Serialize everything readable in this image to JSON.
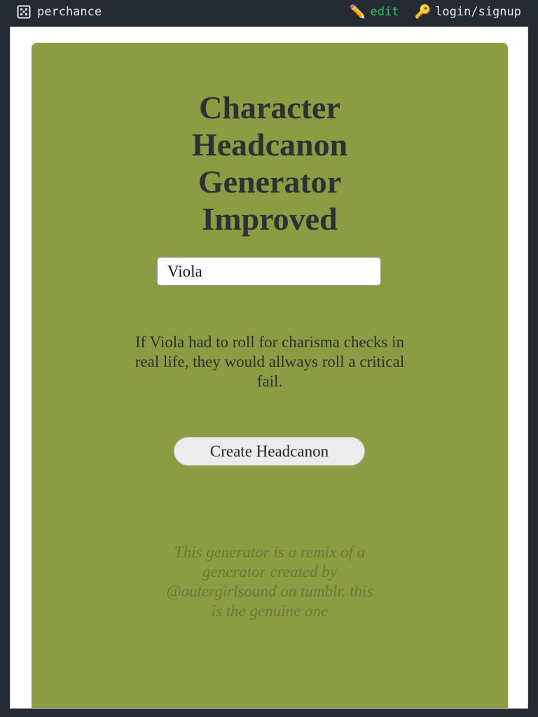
{
  "topbar": {
    "brand_label": "perchance",
    "brand_icon": "dice-icon",
    "edit_label": "edit",
    "edit_icon": "pencil-icon",
    "edit_color": "#22c55e",
    "login_label": "login/signup",
    "login_icon": "key-icon"
  },
  "generator": {
    "title": "Character\nHeadcanon\nGenerator\nImproved",
    "name_value": "Viola",
    "result_text": "If Viola had to roll for charisma checks in real life, they would allways roll a critical fail.",
    "button_label": "Create Headcanon",
    "credit_text": "This generator is a remix of a generator created by @outergirlsound on tumblr. this is the genuine one",
    "card_color": "#8b9c42"
  }
}
